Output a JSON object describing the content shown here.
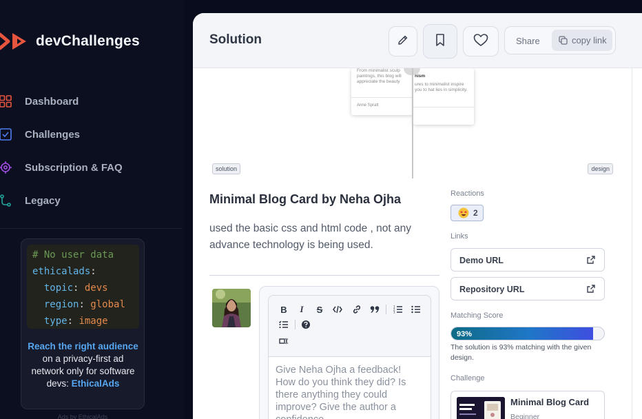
{
  "brand": {
    "name": "devChallenges"
  },
  "nav": [
    {
      "label": "Dashboard",
      "icon": "dashboard-icon"
    },
    {
      "label": "Challenges",
      "icon": "challenges-icon"
    },
    {
      "label": "Subscription & FAQ",
      "icon": "subscription-icon"
    },
    {
      "label": "Legacy",
      "icon": "legacy-icon"
    }
  ],
  "ad": {
    "code": {
      "comment": "# No user data",
      "root": "ethicalads",
      "topic_key": "topic",
      "topic_val": "devs",
      "region_key": "region",
      "region_val": "global",
      "type_key": "type",
      "type_val": "image"
    },
    "link1": "Reach the right audience",
    "text": " on a privacy-first ad network only for software devs: ",
    "link2": "EthicalAds",
    "footer": "Ads by EthicalAds"
  },
  "header": {
    "title": "Solution",
    "share_label": "Share",
    "copy_label": "copy link"
  },
  "preview": {
    "tag_left": "solution",
    "tag_right": "design",
    "snippet1": "From minimalist sculp paintings, this blog will appreciate the beauty",
    "snippet2": "Anne Spratt",
    "snippet3": "nism",
    "snippet4": "ures to minimalist inspire you to hat lies in simplicity."
  },
  "solution": {
    "title": "Minimal Blog Card by Neha Ojha",
    "description": "used the basic css and html code , not any advance technology is being used."
  },
  "editor": {
    "placeholder": "Give Neha Ojha a feedback! How do you think they did? Is there anything they could improve? Give the author a confidence"
  },
  "reactions": {
    "label": "Reactions",
    "count": "2"
  },
  "links": {
    "label": "Links",
    "demo": "Demo URL",
    "repo": "Repository URL"
  },
  "matching": {
    "label": "Matching Score",
    "percent": 93,
    "percent_text": "93%",
    "note": "The solution is 93% matching with the given design."
  },
  "challenge": {
    "label": "Challenge",
    "title": "Minimal Blog Card",
    "level": "Beginner"
  }
}
